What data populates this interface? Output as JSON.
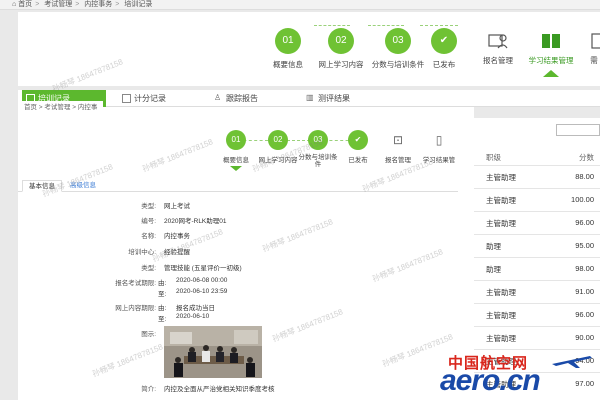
{
  "breadcrumb_top": {
    "items": [
      "首页",
      "考试管理",
      "内控事务",
      "培训记录"
    ]
  },
  "steps_top": [
    {
      "num": "01",
      "label": "概要信息"
    },
    {
      "num": "02",
      "label": "网上学习内容"
    },
    {
      "num": "03",
      "label": "分数与培训条件"
    },
    {
      "num": "",
      "label": "已发布"
    }
  ],
  "icon_tabs_top": [
    {
      "label": "报名管理",
      "icon": "person-card-icon"
    },
    {
      "label": "学习结果管理",
      "icon": "book-icon"
    },
    {
      "label": "需",
      "icon": "partial-icon"
    }
  ],
  "green_tabs": [
    {
      "label": "培训记录",
      "icon": "checkbox-icon"
    },
    {
      "label": "计分记录",
      "icon": "grid-icon"
    },
    {
      "label": "跟踪报告",
      "icon": "person-icon"
    },
    {
      "label": "测评结果",
      "icon": "bar-chart-icon"
    }
  ],
  "breadcrumb_inner": {
    "items": [
      "首页",
      "考试管理",
      "内控事"
    ]
  },
  "steps_inner": [
    {
      "num": "01",
      "label": "概要信息"
    },
    {
      "num": "02",
      "label": "网上学习内容"
    },
    {
      "num": "03",
      "label": "分数与培训条件"
    },
    {
      "num": "",
      "label": "已发布"
    }
  ],
  "icon_tabs_inner": [
    {
      "label": "报名管理"
    },
    {
      "label": "学习结果管"
    }
  ],
  "sub_tabs": {
    "basic": "基本信息",
    "advanced": "高级信息"
  },
  "form": {
    "type_label": "类型:",
    "type_value": "网上考试",
    "code_label": "编号:",
    "code_value": "2020网考-RLK助理01",
    "name_label": "名称:",
    "name_value": "内控事务",
    "center_label": "培训中心:",
    "center_value": "经验提醒",
    "category_label": "类型:",
    "category_value": "管理技能 (五星评价一初级)",
    "exam_period_label": "报名考试期限:",
    "from_label": "由:",
    "from_value": "2020-06-08 00:00",
    "to_label": "至:",
    "to_value": "2020-06-10 23:59",
    "online_label": "网上内容期限:",
    "online_from_value": "报名成功当日",
    "online_to_value": "2020-06-10",
    "image_label": "图示:",
    "intro_label": "简介:",
    "intro_value": "内控及全面从严治党相关知识季度考核"
  },
  "right_table": {
    "header_job": "职级",
    "header_score": "分数",
    "rows": [
      {
        "job": "主管助理",
        "score": "88.00"
      },
      {
        "job": "主管助理",
        "score": "100.00"
      },
      {
        "job": "主管助理",
        "score": "96.00"
      },
      {
        "job": "助理",
        "score": "95.00"
      },
      {
        "job": "助理",
        "score": "98.00"
      },
      {
        "job": "主管助理",
        "score": "91.00"
      },
      {
        "job": "主管助理",
        "score": "96.00"
      },
      {
        "job": "主管助理",
        "score": "90.00"
      },
      {
        "job": "主管助理",
        "score": "94.00"
      },
      {
        "job": "主管助理",
        "score": "97.00"
      }
    ]
  },
  "watermark_text": "孙畅琴 18647878158",
  "logo": {
    "cn": "中国航空网",
    "en": "aero.cn"
  },
  "colors": {
    "accent": "#5cb82e",
    "link": "#3a7bd5",
    "logo_red": "#d9261c",
    "logo_blue": "#1a4aa8"
  }
}
